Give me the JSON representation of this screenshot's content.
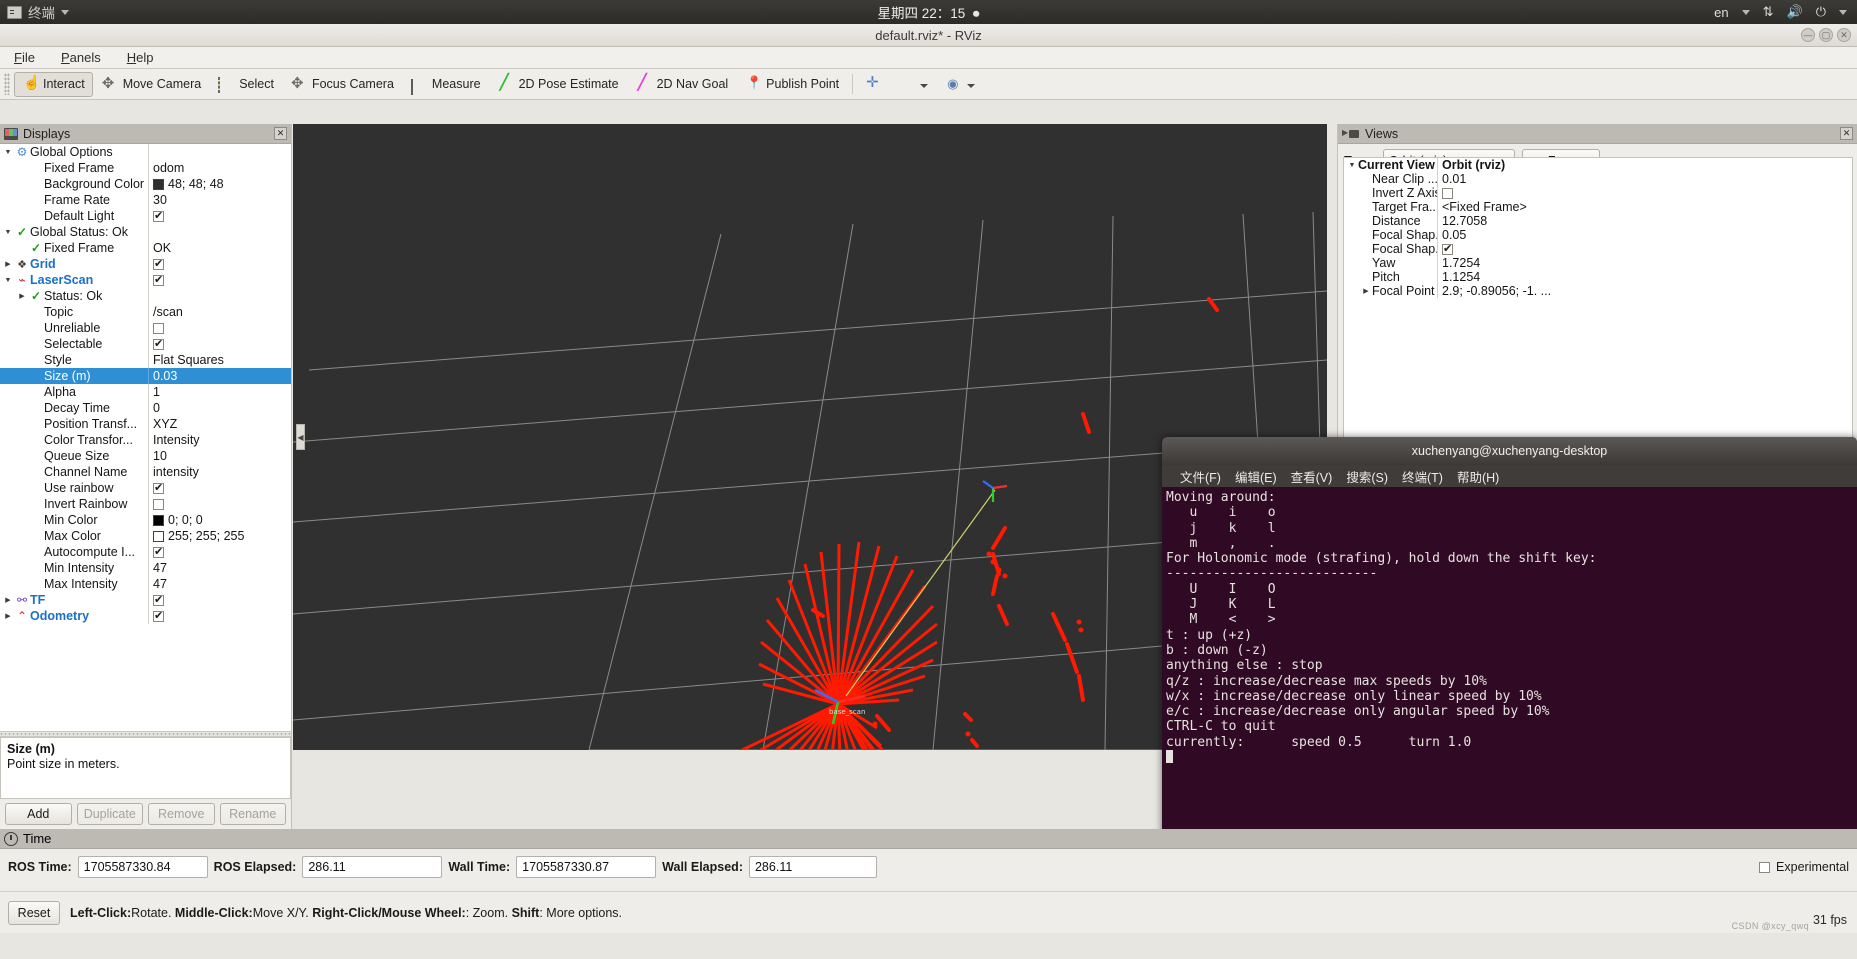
{
  "unity_bar": {
    "app_name": "终端",
    "clock": "星期四 22：15",
    "keyboard": "en",
    "icons": [
      "terminal-app-icon",
      "dropdown-caret-icon",
      "record-dot-icon",
      "network-icon",
      "volume-icon",
      "power-icon",
      "session-caret-icon"
    ]
  },
  "window": {
    "title": "default.rviz* - RViz",
    "buttons": [
      "minimize",
      "maximize",
      "close"
    ]
  },
  "menu": {
    "items": [
      "File",
      "Panels",
      "Help"
    ]
  },
  "toolbar": {
    "buttons": [
      {
        "label": "Interact",
        "icon": "hand-pointer-icon",
        "active": true
      },
      {
        "label": "Move Camera",
        "icon": "move-camera-icon",
        "active": false
      },
      {
        "label": "Select",
        "icon": "select-rect-icon",
        "active": false
      },
      {
        "label": "Focus Camera",
        "icon": "focus-camera-icon",
        "active": false
      },
      {
        "label": "Measure",
        "icon": "measure-icon",
        "active": false
      },
      {
        "label": "2D Pose Estimate",
        "icon": "pose-estimate-arrow-icon",
        "active": false
      },
      {
        "label": "2D Nav Goal",
        "icon": "nav-goal-arrow-icon",
        "active": false
      },
      {
        "label": "Publish Point",
        "icon": "publish-point-pin-icon",
        "active": false
      }
    ],
    "extra_icons": [
      "add-tool-icon",
      "remove-tool-icon",
      "tool-properties-icon"
    ]
  },
  "displays": {
    "title": "Displays",
    "rows": [
      {
        "indent": 0,
        "arrow": "down",
        "icon": "gear-icon",
        "name": "Global Options",
        "value": "",
        "vtype": "text",
        "bold_blue": false
      },
      {
        "indent": 1,
        "arrow": "",
        "icon": "",
        "name": "Fixed Frame",
        "value": "odom",
        "vtype": "text"
      },
      {
        "indent": 1,
        "arrow": "",
        "icon": "",
        "name": "Background Color",
        "value": "48; 48; 48",
        "vtype": "color",
        "color": "#303030"
      },
      {
        "indent": 1,
        "arrow": "",
        "icon": "",
        "name": "Frame Rate",
        "value": "30",
        "vtype": "text"
      },
      {
        "indent": 1,
        "arrow": "",
        "icon": "",
        "name": "Default Light",
        "value": "",
        "vtype": "check",
        "checked": true
      },
      {
        "indent": 0,
        "arrow": "down",
        "icon": "check-icon",
        "name": "Global Status: Ok",
        "value": "",
        "vtype": "text"
      },
      {
        "indent": 1,
        "arrow": "",
        "icon": "check-icon",
        "name": "Fixed Frame",
        "value": "OK",
        "vtype": "text"
      },
      {
        "indent": 0,
        "arrow": "right",
        "icon": "grid-icon",
        "name": "Grid",
        "value": "",
        "vtype": "check",
        "checked": true,
        "bold_blue": true
      },
      {
        "indent": 0,
        "arrow": "down",
        "icon": "laserscan-icon",
        "name": "LaserScan",
        "value": "",
        "vtype": "check",
        "checked": true,
        "bold_blue": true
      },
      {
        "indent": 1,
        "arrow": "right",
        "icon": "check-icon",
        "name": "Status: Ok",
        "value": "",
        "vtype": "text"
      },
      {
        "indent": 1,
        "arrow": "",
        "icon": "",
        "name": "Topic",
        "value": "/scan",
        "vtype": "text"
      },
      {
        "indent": 1,
        "arrow": "",
        "icon": "",
        "name": "Unreliable",
        "value": "",
        "vtype": "check",
        "checked": false
      },
      {
        "indent": 1,
        "arrow": "",
        "icon": "",
        "name": "Selectable",
        "value": "",
        "vtype": "check",
        "checked": true
      },
      {
        "indent": 1,
        "arrow": "",
        "icon": "",
        "name": "Style",
        "value": "Flat Squares",
        "vtype": "text"
      },
      {
        "indent": 1,
        "arrow": "",
        "icon": "",
        "name": "Size (m)",
        "value": "0.03",
        "vtype": "text",
        "selected": true
      },
      {
        "indent": 1,
        "arrow": "",
        "icon": "",
        "name": "Alpha",
        "value": "1",
        "vtype": "text"
      },
      {
        "indent": 1,
        "arrow": "",
        "icon": "",
        "name": "Decay Time",
        "value": "0",
        "vtype": "text"
      },
      {
        "indent": 1,
        "arrow": "",
        "icon": "",
        "name": "Position Transf...",
        "value": "XYZ",
        "vtype": "text"
      },
      {
        "indent": 1,
        "arrow": "",
        "icon": "",
        "name": "Color Transfor...",
        "value": "Intensity",
        "vtype": "text"
      },
      {
        "indent": 1,
        "arrow": "",
        "icon": "",
        "name": "Queue Size",
        "value": "10",
        "vtype": "text"
      },
      {
        "indent": 1,
        "arrow": "",
        "icon": "",
        "name": "Channel Name",
        "value": "intensity",
        "vtype": "text"
      },
      {
        "indent": 1,
        "arrow": "",
        "icon": "",
        "name": "Use rainbow",
        "value": "",
        "vtype": "check",
        "checked": true
      },
      {
        "indent": 1,
        "arrow": "",
        "icon": "",
        "name": "Invert Rainbow",
        "value": "",
        "vtype": "check",
        "checked": false
      },
      {
        "indent": 1,
        "arrow": "",
        "icon": "",
        "name": "Min Color",
        "value": "0; 0; 0",
        "vtype": "color",
        "color": "#000000"
      },
      {
        "indent": 1,
        "arrow": "",
        "icon": "",
        "name": "Max Color",
        "value": "255; 255; 255",
        "vtype": "color",
        "color": "#ffffff"
      },
      {
        "indent": 1,
        "arrow": "",
        "icon": "",
        "name": "Autocompute I...",
        "value": "",
        "vtype": "check",
        "checked": true
      },
      {
        "indent": 1,
        "arrow": "",
        "icon": "",
        "name": "Min Intensity",
        "value": "47",
        "vtype": "text"
      },
      {
        "indent": 1,
        "arrow": "",
        "icon": "",
        "name": "Max Intensity",
        "value": "47",
        "vtype": "text"
      },
      {
        "indent": 0,
        "arrow": "right",
        "icon": "tf-axes-icon",
        "name": "TF",
        "value": "",
        "vtype": "check",
        "checked": true,
        "bold_blue": true
      },
      {
        "indent": 0,
        "arrow": "right",
        "icon": "odometry-icon",
        "name": "Odometry",
        "value": "",
        "vtype": "check",
        "checked": true,
        "bold_blue": true
      }
    ],
    "description": {
      "title": "Size (m)",
      "text": "Point size in meters."
    },
    "buttons": [
      {
        "label": "Add",
        "enabled": true
      },
      {
        "label": "Duplicate",
        "enabled": false
      },
      {
        "label": "Remove",
        "enabled": false
      },
      {
        "label": "Rename",
        "enabled": false
      }
    ]
  },
  "views": {
    "title": "Views",
    "type_label": "Type:",
    "type_value": "Orbit (rviz)",
    "zero_label": "Zero",
    "rows": [
      {
        "indent": 0,
        "arrow": "down",
        "name": "Current View",
        "value": "Orbit (rviz)",
        "vtype": "text",
        "bold": true
      },
      {
        "indent": 1,
        "arrow": "",
        "name": "Near Clip ...",
        "value": "0.01",
        "vtype": "text"
      },
      {
        "indent": 1,
        "arrow": "",
        "name": "Invert Z Axis",
        "value": "",
        "vtype": "check",
        "checked": false
      },
      {
        "indent": 1,
        "arrow": "",
        "name": "Target Fra...",
        "value": "<Fixed Frame>",
        "vtype": "text"
      },
      {
        "indent": 1,
        "arrow": "",
        "name": "Distance",
        "value": "12.7058",
        "vtype": "text"
      },
      {
        "indent": 1,
        "arrow": "",
        "name": "Focal Shap...",
        "value": "0.05",
        "vtype": "text"
      },
      {
        "indent": 1,
        "arrow": "",
        "name": "Focal Shap...",
        "value": "",
        "vtype": "check",
        "checked": true
      },
      {
        "indent": 1,
        "arrow": "",
        "name": "Yaw",
        "value": "1.7254",
        "vtype": "text"
      },
      {
        "indent": 1,
        "arrow": "",
        "name": "Pitch",
        "value": "1.1254",
        "vtype": "text"
      },
      {
        "indent": 1,
        "arrow": "right",
        "name": "Focal Point",
        "value": "2.9; -0.89056; -1. ...",
        "vtype": "text"
      }
    ]
  },
  "terminal": {
    "title": "xuchenyang@xuchenyang-desktop",
    "menu": [
      "文件(F)",
      "编辑(E)",
      "查看(V)",
      "搜索(S)",
      "终端(T)",
      "帮助(H)"
    ],
    "lines": [
      "Moving around:",
      "   u    i    o",
      "   j    k    l",
      "   m    ,    .",
      "",
      "For Holonomic mode (strafing), hold down the shift key:",
      "---------------------------",
      "   U    I    O",
      "   J    K    L",
      "   M    <    >",
      "",
      "t : up (+z)",
      "b : down (-z)",
      "",
      "anything else : stop",
      "",
      "q/z : increase/decrease max speeds by 10%",
      "w/x : increase/decrease only linear speed by 10%",
      "e/c : increase/decrease only angular speed by 10%",
      "",
      "CTRL-C to quit",
      "",
      "currently:\tspeed 0.5\tturn 1.0 "
    ]
  },
  "time_panel": {
    "title": "Time",
    "fields": [
      {
        "label": "ROS Time:",
        "value": "1705587330.84"
      },
      {
        "label": "ROS Elapsed:",
        "value": "286.11"
      },
      {
        "label": "Wall Time:",
        "value": "1705587330.87"
      },
      {
        "label": "Wall Elapsed:",
        "value": "286.11"
      }
    ],
    "experimental_label": "Experimental",
    "experimental_checked": false
  },
  "status_bar": {
    "reset_label": "Reset",
    "hints": [
      {
        "key": "Left-Click:",
        "text": "Rotate."
      },
      {
        "key": "Middle-Click:",
        "text": "Move X/Y."
      },
      {
        "key": "Right-Click/Mouse Wheel:",
        "text": ": Zoom."
      },
      {
        "key": "Shift",
        "text": ": More options."
      }
    ],
    "fps": "31 fps",
    "watermark": "CSDN @xcy_qwq"
  },
  "viewport": {
    "grid_color": "#9a9a9a",
    "background": "#303030",
    "scan_color": "#ff0000",
    "axis_label": "base_scan"
  }
}
